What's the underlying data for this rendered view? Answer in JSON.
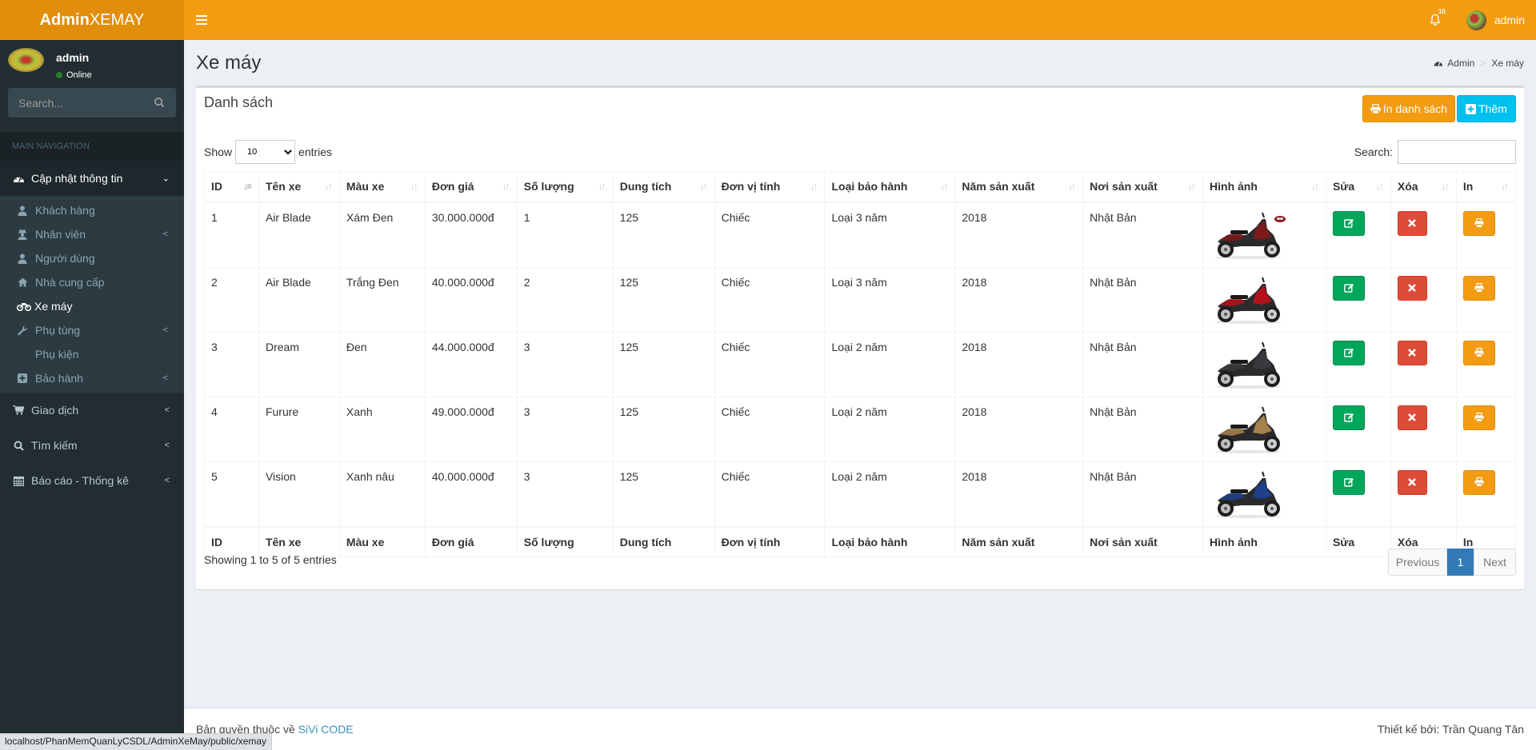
{
  "header": {
    "logo_bold": "Admin",
    "logo_light": "XEMAY",
    "notification_count": "10",
    "user_name": "admin"
  },
  "sidebar": {
    "user": {
      "name": "admin",
      "status": "Online"
    },
    "search_placeholder": "Search...",
    "nav_header": "MAIN NAVIGATION",
    "menu": [
      {
        "label": "Cập nhật thông tin",
        "icon": "dashboard-icon",
        "expanded": true
      },
      {
        "label": "Giao dịch",
        "icon": "shopping-cart-icon"
      },
      {
        "label": "Tìm kiếm",
        "icon": "search-icon"
      },
      {
        "label": "Báo cáo - Thống kê",
        "icon": "calendar-icon"
      }
    ],
    "submenu": [
      {
        "label": "Khách hàng",
        "icon": "user-md-icon"
      },
      {
        "label": "Nhân viên",
        "icon": "user-secret-icon",
        "has_children": true
      },
      {
        "label": "Người dùng",
        "icon": "user-icon"
      },
      {
        "label": "Nhà cung cấp",
        "icon": "home-icon"
      },
      {
        "label": "Xe máy",
        "icon": "motorcycle-icon",
        "active": true
      },
      {
        "label": "Phụ tùng",
        "icon": "wrench-icon",
        "has_children": true
      },
      {
        "label": "Phụ kiện",
        "icon": ""
      },
      {
        "label": "Bảo hành",
        "icon": "plus-square-icon",
        "has_children": true
      }
    ]
  },
  "page": {
    "title": "Xe máy",
    "breadcrumb": [
      "Admin",
      "Xe máy"
    ]
  },
  "box": {
    "title": "Danh sách",
    "print_list_label": "In danh sách",
    "add_label": "Thêm",
    "show_label": "Show",
    "entries_label": "entries",
    "page_length": "10",
    "search_label": "Search:",
    "search_value": ""
  },
  "table": {
    "columns": [
      "ID",
      "Tên xe",
      "Màu xe",
      "Đơn giá",
      "Số lượng",
      "Dung tích",
      "Đơn vị tính",
      "Loại bảo hành",
      "Năm sản xuất",
      "Nơi sản xuất",
      "Hình ảnh",
      "Sửa",
      "Xóa",
      "In"
    ],
    "rows": [
      {
        "id": "1",
        "ten": "Air Blade",
        "mau": "Xám Đen",
        "gia": "30.000.000đ",
        "sl": "1",
        "dt": "125",
        "dvt": "Chiếc",
        "bh": "Loại 3 năm",
        "nam": "2018",
        "noi": "Nhật Bản",
        "color": "#2b2b2e",
        "accent": "#7a1a1a"
      },
      {
        "id": "2",
        "ten": "Air Blade",
        "mau": "Trắng Đen",
        "gia": "40.000.000đ",
        "sl": "2",
        "dt": "125",
        "dvt": "Chiếc",
        "bh": "Loại 3 năm",
        "nam": "2018",
        "noi": "Nhật Bản",
        "color": "#2b2b2e",
        "accent": "#b3121c"
      },
      {
        "id": "3",
        "ten": "Dream",
        "mau": "Đen",
        "gia": "44.000.000đ",
        "sl": "3",
        "dt": "125",
        "dvt": "Chiếc",
        "bh": "Loại 2 năm",
        "nam": "2018",
        "noi": "Nhật Bản",
        "color": "#2a2a2c",
        "accent": "#3a3a3e"
      },
      {
        "id": "4",
        "ten": "Furure",
        "mau": "Xanh",
        "gia": "49.000.000đ",
        "sl": "3",
        "dt": "125",
        "dvt": "Chiếc",
        "bh": "Loại 2 năm",
        "nam": "2018",
        "noi": "Nhật Bản",
        "color": "#2a2a2c",
        "accent": "#a4814d"
      },
      {
        "id": "5",
        "ten": "Vision",
        "mau": "Xanh nâu",
        "gia": "40.000.000đ",
        "sl": "3",
        "dt": "125",
        "dvt": "Chiếc",
        "bh": "Loại 2 năm",
        "nam": "2018",
        "noi": "Nhật Bản",
        "color": "#2a2a2c",
        "accent": "#1f3f8a"
      }
    ],
    "info": "Showing 1 to 5 of 5 entries",
    "pagination": {
      "previous": "Previous",
      "current": "1",
      "next": "Next"
    }
  },
  "footer": {
    "copyright_prefix": "Bản quyền thuộc về",
    "copyright_link": "SiVi CODE",
    "designer": "Thiết kế bởi: Trần Quang Tân"
  },
  "status_bar_url": "localhost/PhanMemQuanLyCSDL/AdminXeMay/public/xemay",
  "colors": {
    "header": "#f39c12",
    "logo": "#e08e0b",
    "sidebar": "#222d32",
    "edit": "#00a65a",
    "delete": "#dd4b39",
    "print": "#f39c12",
    "add": "#00c0ef",
    "page_active": "#337ab7"
  }
}
